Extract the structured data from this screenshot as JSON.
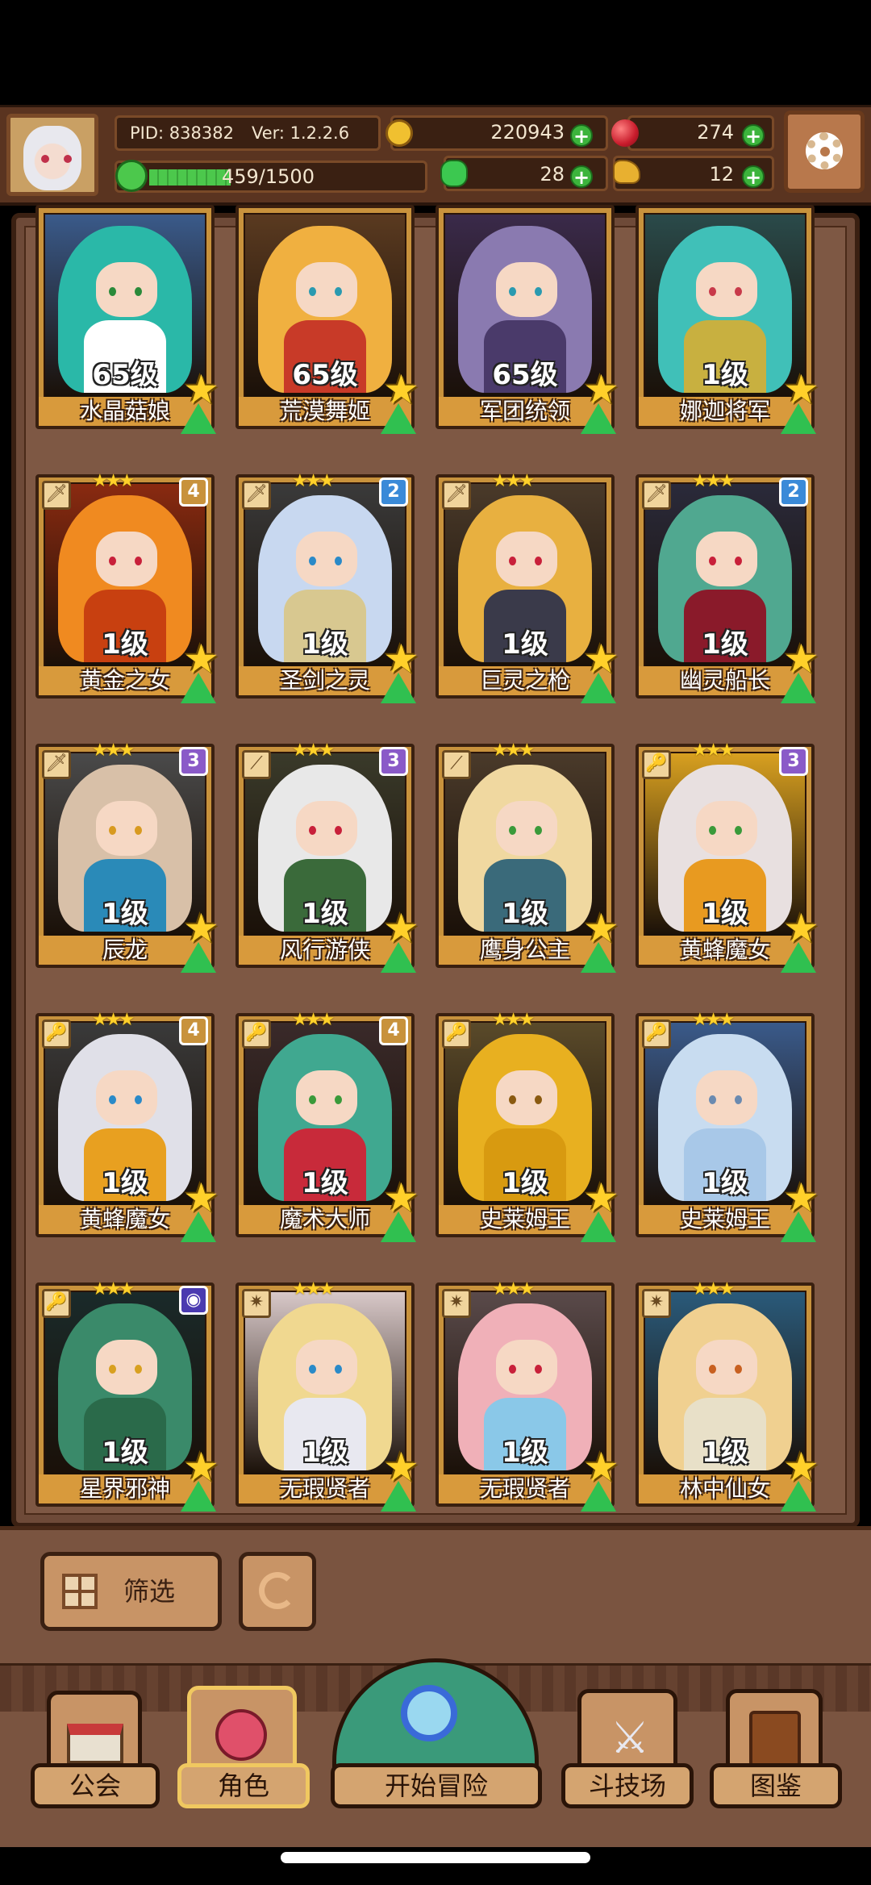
{
  "header": {
    "pid": "PID: 838382",
    "version": "Ver: 1.2.2.6",
    "gold": "220943",
    "gems": "274",
    "xp": "459/1500",
    "xp_progress": 0.306,
    "clover": "28",
    "keys": "12",
    "icons": {
      "gold": "coin-icon",
      "gem": "gem-icon",
      "clover": "clover-icon",
      "key": "key-icon",
      "settings": "gear-icon"
    }
  },
  "characters": [
    {
      "name": "水晶菇娘",
      "level": "65级",
      "hair": "#2ab8a8",
      "body": "#ffffff",
      "bg": "#3a5a8a",
      "eye": "#2a8a3a",
      "weapon": "",
      "badge": "",
      "badge_color": ""
    },
    {
      "name": "荒漠舞姬",
      "level": "65级",
      "hair": "#f0b040",
      "body": "#c83a28",
      "bg": "#5a3a20",
      "eye": "#2a9ab0",
      "weapon": "",
      "badge": "",
      "badge_color": ""
    },
    {
      "name": "军团统领",
      "level": "65级",
      "hair": "#8a7ab0",
      "body": "#4a3a6a",
      "bg": "#3a2a4a",
      "eye": "#2a9ab0",
      "weapon": "",
      "badge": "",
      "badge_color": ""
    },
    {
      "name": "娜迦将军",
      "level": "1级",
      "hair": "#40c0b8",
      "body": "#c8b040",
      "bg": "#2a4a4a",
      "eye": "#c83a4a",
      "weapon": "",
      "badge": "",
      "badge_color": ""
    },
    {
      "name": "黄金之女",
      "level": "1级",
      "hair": "#f08a20",
      "body": "#c84010",
      "bg": "#8a2a10",
      "eye": "#c8203a",
      "weapon": "🗡",
      "badge": "4",
      "badge_color": "#c8923c"
    },
    {
      "name": "圣剑之灵",
      "level": "1级",
      "hair": "#c8d8f0",
      "body": "#d8c890",
      "bg": "#3a3a3a",
      "eye": "#2a8ac8",
      "weapon": "🗡",
      "badge": "2",
      "badge_color": "#3a8ad8"
    },
    {
      "name": "巨灵之枪",
      "level": "1级",
      "hair": "#e8b040",
      "body": "#3a3a4a",
      "bg": "#4a3a2a",
      "eye": "#c8203a",
      "weapon": "🗡",
      "badge": "",
      "badge_color": ""
    },
    {
      "name": "幽灵船长",
      "level": "1级",
      "hair": "#50a890",
      "body": "#8a1a2a",
      "bg": "#2a2a3a",
      "eye": "#c8203a",
      "weapon": "🗡",
      "badge": "2",
      "badge_color": "#3a8ad8"
    },
    {
      "name": "辰龙",
      "level": "1级",
      "hair": "#d8c0a8",
      "body": "#2a8ab8",
      "bg": "#4a4a4a",
      "eye": "#d89a20",
      "weapon": "🗡",
      "badge": "3",
      "badge_color": "#8a5ac8"
    },
    {
      "name": "风行游侠",
      "level": "1级",
      "hair": "#e8e8e8",
      "body": "#3a6a3a",
      "bg": "#3a3a2a",
      "eye": "#c8203a",
      "weapon": "⟋",
      "badge": "3",
      "badge_color": "#8a5ac8"
    },
    {
      "name": "鹰身公主",
      "level": "1级",
      "hair": "#f0d8a0",
      "body": "#3a6a7a",
      "bg": "#4a3a2a",
      "eye": "#3a9a3a",
      "weapon": "⟋",
      "badge": "",
      "badge_color": ""
    },
    {
      "name": "黄蜂魔女",
      "level": "1级",
      "hair": "#e8e0e0",
      "body": "#e89a20",
      "bg": "#d8a020",
      "eye": "#3a9a3a",
      "weapon": "🔑",
      "badge": "3",
      "badge_color": "#8a5ac8"
    },
    {
      "name": "黄蜂魔女",
      "level": "1级",
      "hair": "#e0e0e8",
      "body": "#e8a020",
      "bg": "#3a3a3a",
      "eye": "#2a8ac8",
      "weapon": "🔑",
      "badge": "4",
      "badge_color": "#c8923c"
    },
    {
      "name": "魔术大师",
      "level": "1级",
      "hair": "#40a890",
      "body": "#c82a3a",
      "bg": "#3a2a2a",
      "eye": "#3a9a3a",
      "weapon": "🔑",
      "badge": "4",
      "badge_color": "#c8923c"
    },
    {
      "name": "史莱姆王",
      "level": "1级",
      "hair": "#e8b020",
      "body": "#d89a10",
      "bg": "#5a4a2a",
      "eye": "#8a5a10",
      "weapon": "🔑",
      "badge": "",
      "badge_color": ""
    },
    {
      "name": "史莱姆王",
      "level": "1级",
      "hair": "#c8dcf0",
      "body": "#a8c8e8",
      "bg": "#3a5a8a",
      "eye": "#6a8ab0",
      "weapon": "🔑",
      "badge": "",
      "badge_color": ""
    },
    {
      "name": "星界邪神",
      "level": "1级",
      "hair": "#3a8a6a",
      "body": "#2a6a4a",
      "bg": "#1a2a2a",
      "eye": "#d8a020",
      "weapon": "🔑",
      "badge": "◉",
      "badge_color": "#4a3ab0"
    },
    {
      "name": "无瑕贤者",
      "level": "1级",
      "hair": "#f0d890",
      "body": "#e8e8f0",
      "bg": "#d8c8c8",
      "eye": "#2a8ac8",
      "weapon": "✷",
      "badge": "",
      "badge_color": ""
    },
    {
      "name": "无瑕贤者",
      "level": "1级",
      "hair": "#f0b0b8",
      "body": "#8ac8e8",
      "bg": "#5a4a4a",
      "eye": "#c8203a",
      "weapon": "✷",
      "badge": "",
      "badge_color": ""
    },
    {
      "name": "林中仙女",
      "level": "1级",
      "hair": "#f0d090",
      "body": "#e8e0c8",
      "bg": "#2a5a7a",
      "eye": "#c86020",
      "weapon": "✷",
      "badge": "",
      "badge_color": ""
    }
  ],
  "controls": {
    "filter_label": "筛选"
  },
  "nav": {
    "items": [
      {
        "label": "公会",
        "icon": "guild-hall-icon"
      },
      {
        "label": "角色",
        "icon": "character-icon"
      },
      {
        "label": "开始冒险",
        "icon": "map-search-icon"
      },
      {
        "label": "斗技场",
        "icon": "crossed-swords-icon"
      },
      {
        "label": "图鉴",
        "icon": "book-icon"
      }
    ]
  }
}
